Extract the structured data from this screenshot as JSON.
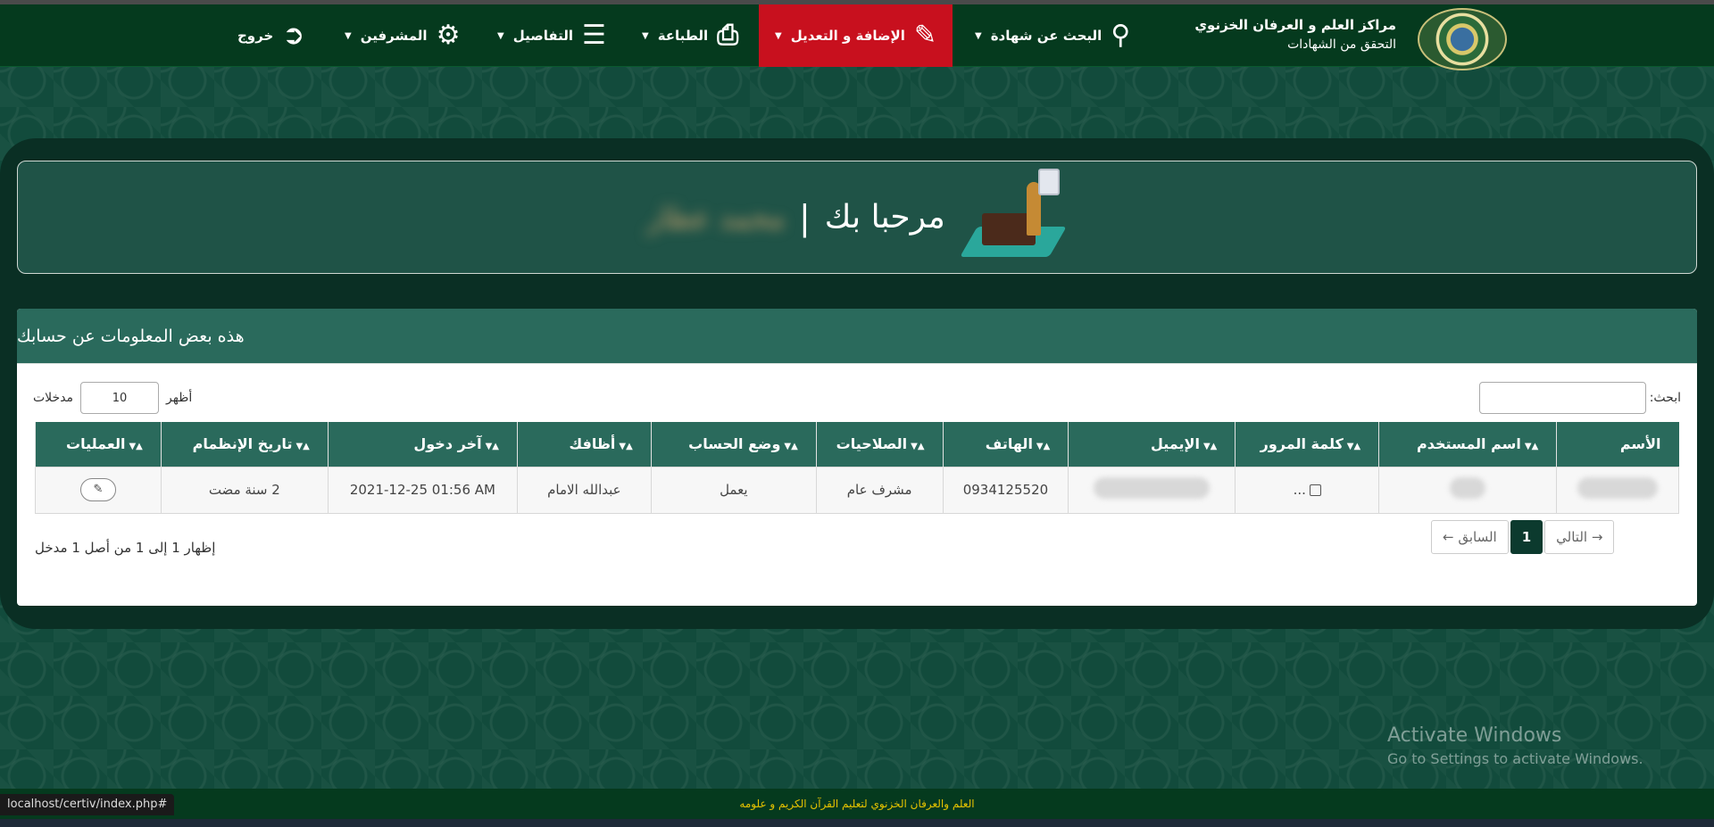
{
  "brand": {
    "title": "مراكز العلم و العرفان الخزنوي",
    "subtitle": "التحقق من الشهادات"
  },
  "nav": {
    "search": "البحث عن شهادة",
    "add_edit": "الإضافة و التعديل",
    "print": "الطباعة",
    "details": "التفاصيل",
    "supervisors": "المشرفين",
    "logout": "خروج",
    "active_color": "#c8101e"
  },
  "welcome": {
    "title": "مرحبا بك",
    "separator": "|",
    "name": "محمد عطار"
  },
  "card": {
    "header": "هذه بعض المعلومات عن حسابك",
    "search_label": "ابحث:",
    "show_label": "أظهر",
    "entries_count": "10",
    "entries_label": "مدخلات",
    "columns": [
      "الأسم",
      "اسم المستخدم",
      "كلمة المرور",
      "الإيميل",
      "الهاتف",
      "الصلاحيات",
      "وضع الحساب",
      "أظافك",
      "آخر دخول",
      "تاريخ الإنظمام",
      "العمليات"
    ],
    "row": {
      "password": "...",
      "phone": "0934125520",
      "role": "مشرف عام",
      "status": "يعمل",
      "added_by": "عبدالله الامام",
      "last_login": "2021-12-25 01:56 AM",
      "joined": "2 سنة مضت",
      "edit": "✎"
    },
    "info": "إظهار 1 إلى 1 من أصل 1 مدخل",
    "pager": {
      "prev": "← السابق",
      "current": "1",
      "next": "التالي →"
    }
  },
  "watermark": {
    "line1": "Activate Windows",
    "line2": "Go to Settings to activate Windows."
  },
  "footer": "العلم والعرفان الخزنوي لتعليم القرآن الكريم و علومه",
  "status_url": "localhost/certiv/index.php#"
}
